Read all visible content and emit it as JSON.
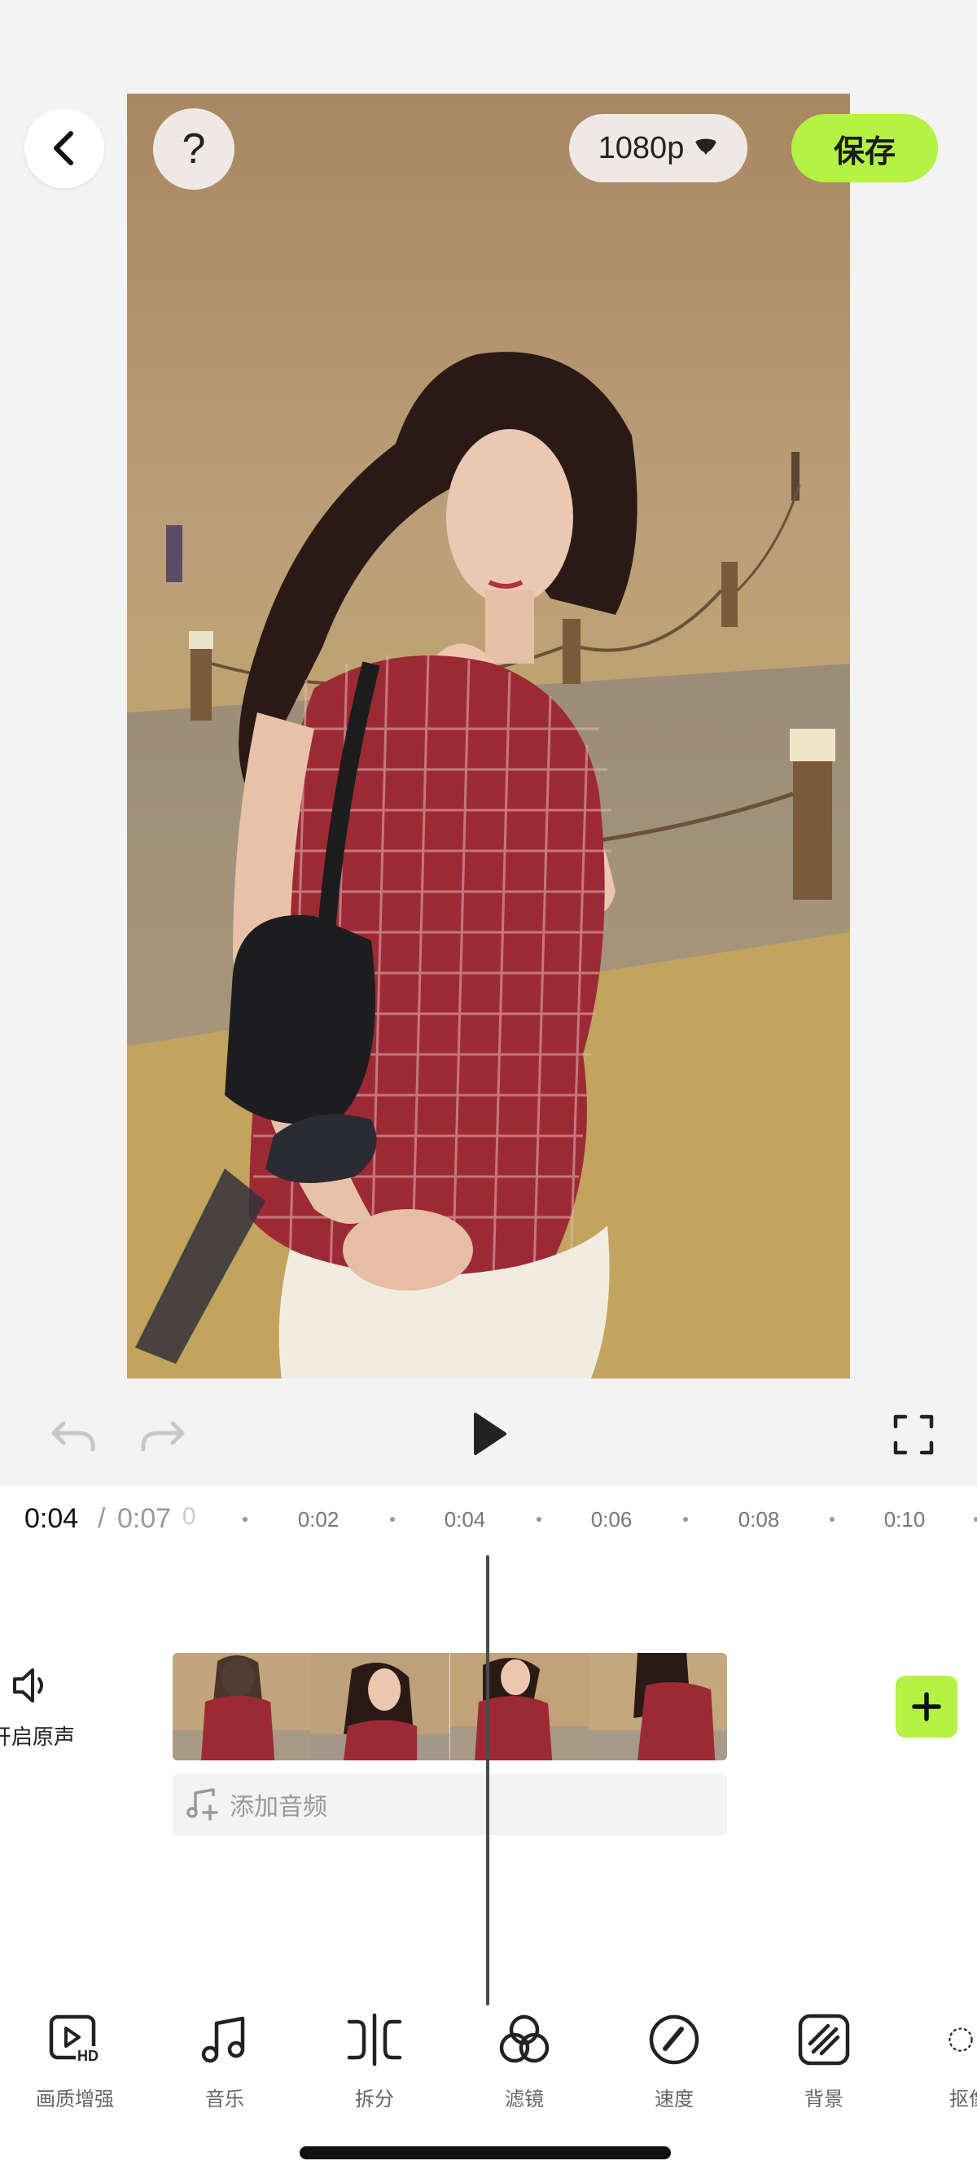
{
  "header": {
    "resolution": "1080p",
    "save_label": "保存",
    "help_label": "?"
  },
  "preview": {
    "image_description_icon": "video-frame"
  },
  "timeline": {
    "current_time": "0:04",
    "separator": "/",
    "total_time": "0:07",
    "fade_glyph": "0",
    "ruler": [
      "0:02",
      "0:04",
      "0:06",
      "0:08",
      "0:10"
    ],
    "audio_toggle_label": "开启原声",
    "add_audio_label": "添加音频",
    "playhead_position_seconds": 4
  },
  "toolbar": {
    "items": [
      {
        "label": "画质增强",
        "icon": "hd-enhance-icon"
      },
      {
        "label": "音乐",
        "icon": "music-note-icon"
      },
      {
        "label": "拆分",
        "icon": "split-icon"
      },
      {
        "label": "滤镜",
        "icon": "filter-icon"
      },
      {
        "label": "速度",
        "icon": "speed-icon"
      },
      {
        "label": "背景",
        "icon": "background-icon"
      },
      {
        "label": "抠像",
        "icon": "cutout-icon"
      }
    ]
  },
  "colors": {
    "accent": "#b4f244",
    "background": "#f3f3f3",
    "panel": "#ffffff"
  }
}
